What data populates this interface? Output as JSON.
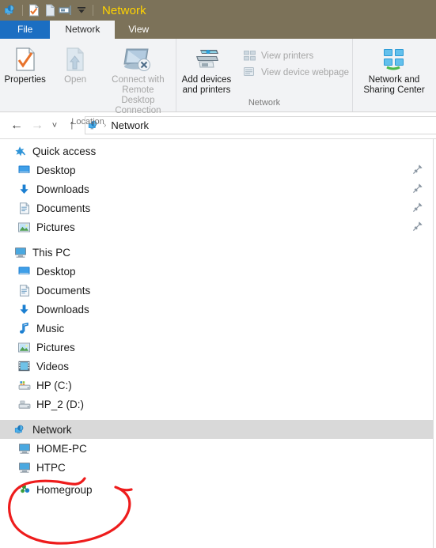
{
  "window": {
    "title": "Network",
    "quick_access_icons": [
      "network-icon",
      "properties-checkmark-icon",
      "new-item-icon",
      "customize-toolbar-icon",
      "customize-quick-access-chevron-icon"
    ]
  },
  "ribbon": {
    "tabs": [
      {
        "label": "File",
        "state": "file-menu"
      },
      {
        "label": "Network",
        "state": "active"
      },
      {
        "label": "View",
        "state": "normal"
      }
    ],
    "groups": [
      {
        "label": "Location",
        "buttons": [
          {
            "label": "Properties",
            "icon": "properties-icon",
            "disabled": false
          },
          {
            "label": "Open",
            "icon": "open-icon",
            "disabled": true
          },
          {
            "label": "Connect with Remote\nDesktop Connection",
            "icon": "remote-desktop-icon",
            "disabled": true
          }
        ]
      },
      {
        "label": "Network",
        "buttons": [
          {
            "label": "Add devices\nand printers",
            "icon": "add-devices-printers-icon",
            "disabled": false
          }
        ],
        "small_buttons": [
          {
            "label": "View printers",
            "icon": "view-printers-icon",
            "disabled": true
          },
          {
            "label": "View device webpage",
            "icon": "view-device-webpage-icon",
            "disabled": true
          }
        ]
      },
      {
        "label": "",
        "buttons": [
          {
            "label": "Network and\nSharing Center",
            "icon": "network-sharing-center-icon",
            "disabled": false
          }
        ]
      }
    ]
  },
  "addressbar": {
    "back": "←",
    "forward": "→",
    "recent": "˅",
    "up": "↑",
    "separator": "›",
    "path_icon": "network-icon",
    "path": "Network"
  },
  "navpane": {
    "sections": [
      {
        "name": "quick-access",
        "root": {
          "label": "Quick access",
          "icon": "star-pin-icon"
        },
        "children": [
          {
            "label": "Desktop",
            "icon": "desktop-icon",
            "pinned": true
          },
          {
            "label": "Downloads",
            "icon": "downloads-icon",
            "pinned": true
          },
          {
            "label": "Documents",
            "icon": "documents-icon",
            "pinned": true
          },
          {
            "label": "Pictures",
            "icon": "pictures-icon",
            "pinned": true
          }
        ]
      },
      {
        "name": "this-pc",
        "root": {
          "label": "This PC",
          "icon": "this-pc-icon"
        },
        "children": [
          {
            "label": "Desktop",
            "icon": "desktop-icon",
            "pinned": false
          },
          {
            "label": "Documents",
            "icon": "documents-icon",
            "pinned": false
          },
          {
            "label": "Downloads",
            "icon": "downloads-icon",
            "pinned": false
          },
          {
            "label": "Music",
            "icon": "music-icon",
            "pinned": false
          },
          {
            "label": "Pictures",
            "icon": "pictures-icon",
            "pinned": false
          },
          {
            "label": "Videos",
            "icon": "videos-icon",
            "pinned": false
          },
          {
            "label": "HP (C:)",
            "icon": "system-drive-icon",
            "pinned": false
          },
          {
            "label": "HP_2 (D:)",
            "icon": "drive-icon",
            "pinned": false
          }
        ]
      },
      {
        "name": "network",
        "root": {
          "label": "Network",
          "icon": "network-icon",
          "selected": true
        },
        "children": [
          {
            "label": "HOME-PC",
            "icon": "computer-icon",
            "pinned": false
          },
          {
            "label": "HTPC",
            "icon": "computer-icon",
            "pinned": false
          },
          {
            "label": "Homegroup",
            "icon": "homegroup-icon",
            "pinned": false
          }
        ]
      }
    ]
  },
  "annotation": {
    "shape": "hand-drawn-ellipse",
    "color": "#ee1c1c",
    "target": "Homegroup"
  },
  "colors": {
    "titlebar": "#7c7259",
    "title_text": "#ffd300",
    "file_tab": "#1b6ec2",
    "ribbon_bg": "#f2f3f5",
    "selection": "#d9d9d9",
    "annotation_red": "#ee1c1c"
  }
}
